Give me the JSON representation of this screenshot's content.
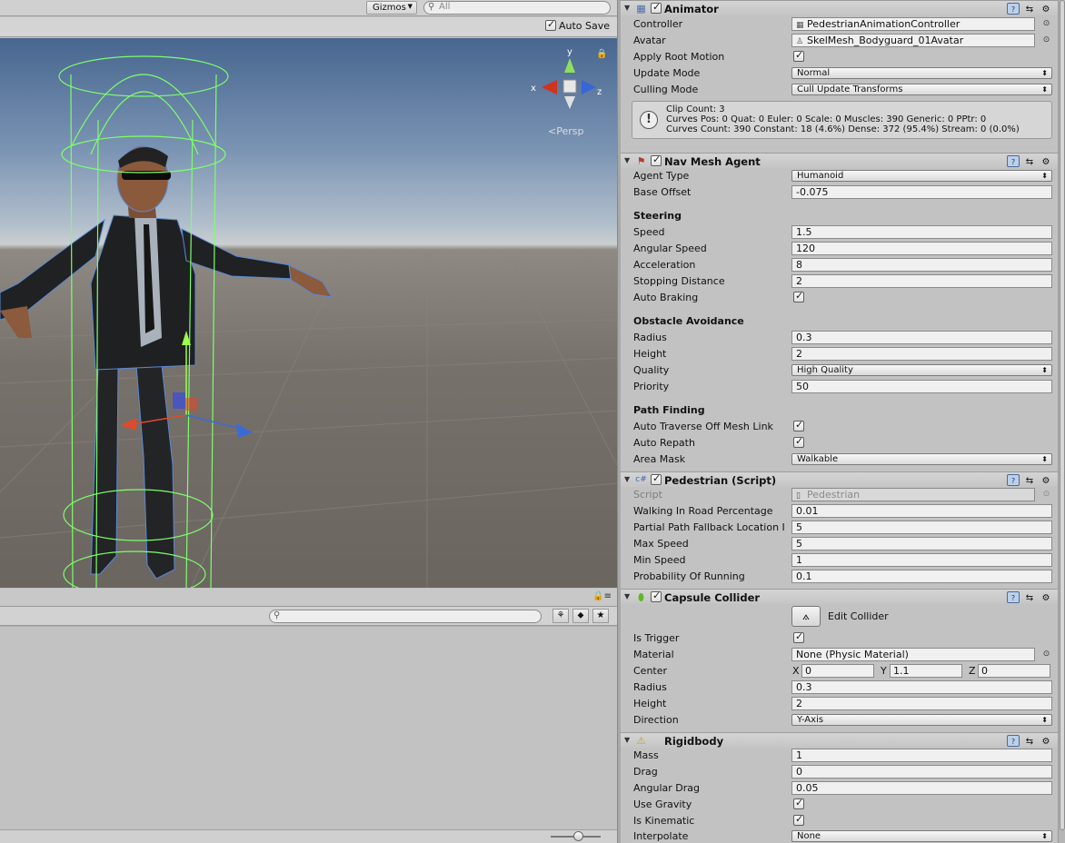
{
  "scene": {
    "gizmos_label": "Gizmos",
    "search_placeholder": "All",
    "auto_save_label": "Auto Save",
    "auto_save_checked": true,
    "persp_label": "Persp",
    "axis_labels": {
      "x": "x",
      "y": "y",
      "z": "z"
    }
  },
  "inspector": {
    "animator": {
      "title": "Animator",
      "enabled": true,
      "rows": {
        "controller_label": "Controller",
        "controller_value": "PedestrianAnimationController",
        "avatar_label": "Avatar",
        "avatar_value": "SkelMesh_Bodyguard_01Avatar",
        "apply_root_motion_label": "Apply Root Motion",
        "apply_root_motion": true,
        "update_mode_label": "Update Mode",
        "update_mode_value": "Normal",
        "culling_mode_label": "Culling Mode",
        "culling_mode_value": "Cull Update Transforms"
      },
      "info_lines": [
        "Clip Count: 3",
        "Curves Pos: 0 Quat: 0 Euler: 0 Scale: 0 Muscles: 390 Generic: 0 PPtr: 0",
        "Curves Count: 390 Constant: 18 (4.6%) Dense: 372 (95.4%) Stream: 0 (0.0%)"
      ]
    },
    "nav_mesh_agent": {
      "title": "Nav Mesh Agent",
      "enabled": true,
      "agent_type_label": "Agent Type",
      "agent_type_value": "Humanoid",
      "base_offset_label": "Base Offset",
      "base_offset_value": "-0.075",
      "steering_header": "Steering",
      "speed_label": "Speed",
      "speed_value": "1.5",
      "angular_speed_label": "Angular Speed",
      "angular_speed_value": "120",
      "acceleration_label": "Acceleration",
      "acceleration_value": "8",
      "stopping_distance_label": "Stopping Distance",
      "stopping_distance_value": "2",
      "auto_braking_label": "Auto Braking",
      "auto_braking": true,
      "obstacle_header": "Obstacle Avoidance",
      "radius_label": "Radius",
      "radius_value": "0.3",
      "height_label": "Height",
      "height_value": "2",
      "quality_label": "Quality",
      "quality_value": "High Quality",
      "priority_label": "Priority",
      "priority_value": "50",
      "pathfinding_header": "Path Finding",
      "auto_traverse_label": "Auto Traverse Off Mesh Link",
      "auto_traverse": true,
      "auto_repath_label": "Auto Repath",
      "auto_repath": true,
      "area_mask_label": "Area Mask",
      "area_mask_value": "Walkable"
    },
    "pedestrian": {
      "title": "Pedestrian (Script)",
      "enabled": true,
      "script_label": "Script",
      "script_value": "Pedestrian",
      "walking_label": "Walking In Road Percentage",
      "walking_value": "0.01",
      "partial_label": "Partial Path Fallback Location I",
      "partial_value": "5",
      "max_speed_label": "Max Speed",
      "max_speed_value": "5",
      "min_speed_label": "Min Speed",
      "min_speed_value": "1",
      "prob_running_label": "Probability Of Running",
      "prob_running_value": "0.1"
    },
    "capsule_collider": {
      "title": "Capsule Collider",
      "enabled": true,
      "edit_collider_label": "Edit Collider",
      "is_trigger_label": "Is Trigger",
      "is_trigger": true,
      "material_label": "Material",
      "material_value": "None (Physic Material)",
      "center_label": "Center",
      "center": {
        "x_label": "X",
        "x": "0",
        "y_label": "Y",
        "y": "1.1",
        "z_label": "Z",
        "z": "0"
      },
      "radius_label": "Radius",
      "radius_value": "0.3",
      "height_label": "Height",
      "height_value": "2",
      "direction_label": "Direction",
      "direction_value": "Y-Axis"
    },
    "rigidbody": {
      "title": "Rigidbody",
      "mass_label": "Mass",
      "mass_value": "1",
      "drag_label": "Drag",
      "drag_value": "0",
      "angular_drag_label": "Angular Drag",
      "angular_drag_value": "0.05",
      "use_gravity_label": "Use Gravity",
      "use_gravity": true,
      "is_kinematic_label": "Is Kinematic",
      "is_kinematic": true,
      "interpolate_label": "Interpolate",
      "interpolate_value": "None"
    }
  },
  "colors": {
    "sky_top": "#47668f",
    "ground": "#77716c",
    "collider_green": "#7dff6a",
    "panel_bg": "#c2c2c2"
  }
}
